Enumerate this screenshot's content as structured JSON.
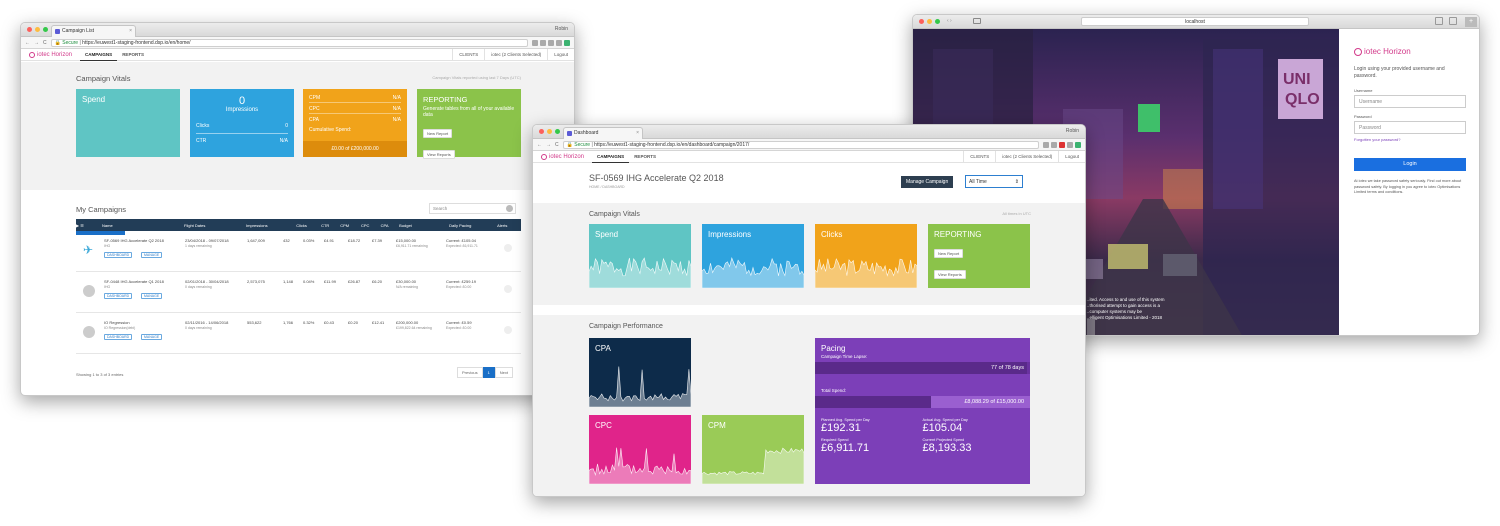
{
  "w1": {
    "tab": "Campaign List",
    "user": "Robin",
    "url_secure": "Secure",
    "url": "https://euwest1-staging-frontend.dsp.io/en/home/",
    "logo": "iotec Horizon",
    "nav": [
      "CAMPAIGNS",
      "REPORTS"
    ],
    "nav_right": [
      "CLIENTS",
      "iotec (2 Clients Selected)",
      "Logout"
    ],
    "vitals_title": "Campaign Vitals",
    "vitals_note": "Campaign Vitals reported using last 7 Days (UTC)",
    "spend": "Spend",
    "impr_value": "0",
    "impr_label": "Impressions",
    "clicks_label": "Clicks",
    "clicks_value": "0",
    "ctr_label": "CTR",
    "ctr_value": "N/A",
    "cost": [
      {
        "k": "CPM",
        "v": "N/A"
      },
      {
        "k": "CPC",
        "v": "N/A"
      },
      {
        "k": "CPA",
        "v": "N/A"
      }
    ],
    "cum_label": "Cumulative Spend:",
    "cum_value": "£0.00 of £200,000.00",
    "reporting": "REPORTING",
    "reporting_text": "Generate tables from all of your available data",
    "new_report": "New Report",
    "view_reports": "View Reports",
    "my_campaigns": "My Campaigns",
    "new_campaign": "+ New Campaign",
    "search_placeholder": "Search",
    "headers": [
      "Name",
      "Flight Dates",
      "Impressions",
      "Clicks",
      "CTR",
      "CPM",
      "CPC",
      "CPA",
      "Budget",
      "Daily Pacing",
      "Alerts"
    ],
    "rows": [
      {
        "name": "SF-0569 IHG Accelerate Q2 2018",
        "client": "IHG",
        "dates": "23/04/2018 - 09/07/2018",
        "remain": "1 days remaining",
        "impr": "1,647,009",
        "clicks": "432",
        "ctr": "0.03%",
        "cpm": "£4.91",
        "cpc": "£18.72",
        "cpa": "£7.39",
        "budget": "£15,000.00",
        "budget_rem": "£6,911.71 remaining",
        "pacing": "Current: £105.04",
        "expected": "Expected: £6,911.71"
      },
      {
        "name": "SF-0448 IHG Accelerate Q1 2018",
        "client": "IHG",
        "dates": "02/01/2018 - 30/04/2018",
        "remain": "0 days remaining",
        "impr": "2,573,075",
        "clicks": "1,148",
        "ctr": "0.04%",
        "cpm": "£11.99",
        "cpc": "£26.87",
        "cpa": "£6.20",
        "budget": "£30,000.00",
        "budget_rem": "N/A remaining",
        "pacing": "Current: £259.19",
        "expected": "Expected: £0.00"
      },
      {
        "name": "IO Regression",
        "client": "IO Regression(debi)",
        "dates": "02/11/2016 - 14/06/2018",
        "remain": "0 days remaining",
        "impr": "553,622",
        "clicks": "1,766",
        "ctr": "0.32%",
        "cpm": "£0.43",
        "cpc": "£0.20",
        "cpa": "£12.41",
        "budget": "£200,000.00",
        "budget_rem": "£199,822.64 remaining",
        "pacing": "Current: £0.59",
        "expected": "Expected: £0.00"
      }
    ],
    "row_btns": [
      "DASHBOARD",
      "MANAGE"
    ],
    "showing": "Showing 1 to 3 of 3 entries",
    "prev": "Previous",
    "page": "1",
    "next": "Next"
  },
  "w2": {
    "tab": "Dashboard",
    "user": "Robin",
    "url_secure": "Secure",
    "url": "https://euwest1-staging-frontend.dsp.io/en/dashboard/campaign/2017/",
    "logo": "iotec Horizon",
    "nav": [
      "CAMPAIGNS",
      "REPORTS"
    ],
    "nav_right": [
      "CLIENTS",
      "iotec (2 Clients Selected)",
      "Logout"
    ],
    "title": "SF-0569 IHG Accelerate Q2 2018",
    "crumb": "HOME / DASHBOARD",
    "manage": "Manage Campaign",
    "range": "All Time",
    "vitals_title": "Campaign Vitals",
    "vitals_note": "All times in UTC",
    "cards": [
      "Spend",
      "Impressions",
      "Clicks"
    ],
    "reporting": "REPORTING",
    "new_report": "New Report",
    "view_reports": "View Reports",
    "perf_title": "Campaign Performance",
    "cpa": "CPA",
    "cpc": "CPC",
    "cpm": "CPM",
    "pacing": "Pacing",
    "time_lapse": "Campaign Time Lapse:",
    "time_value": "77 of 78 days",
    "total_spend": "Total Spend:",
    "spend_value": "£8,088.29 of £15,000.00",
    "time_frac": 0.987,
    "spend_frac": 0.539,
    "stats": [
      {
        "label": "Planned Avg. Spend per Day",
        "value": "£192.31"
      },
      {
        "label": "Actual Avg. Spend per Day",
        "value": "£105.04"
      },
      {
        "label": "Required Spend",
        "value": "£6,911.71"
      },
      {
        "label": "Current Projected Spend",
        "value": "£8,193.33"
      }
    ]
  },
  "w3": {
    "url": "localhost",
    "logo": "iotec Horizon",
    "intro": "Login using your provided username and password.",
    "username_label": "Username",
    "username_placeholder": "Username",
    "password_label": "Password",
    "password_placeholder": "Password",
    "forgot": "Forgotten your password?",
    "login": "Login",
    "legal": "At iotec we take password safety seriously. Find out more about password safety. By logging in you agree to iotec Optimisations Limited terms and conditions.",
    "overlay": [
      "…ited. Access to and use of this system",
      "…thorised attempt to gain access is a",
      "…computer systems may be",
      "…elligent Optimisations Limited - 2018"
    ]
  },
  "colors": {
    "teal": "#5fc5c4",
    "blue": "#2ea3de",
    "orange": "#f1a31a",
    "green": "#8bc34a",
    "navy": "#0d2b4a",
    "magenta": "#e0248a",
    "purple": "#7c3fb8",
    "brand": "#d23a8a"
  }
}
